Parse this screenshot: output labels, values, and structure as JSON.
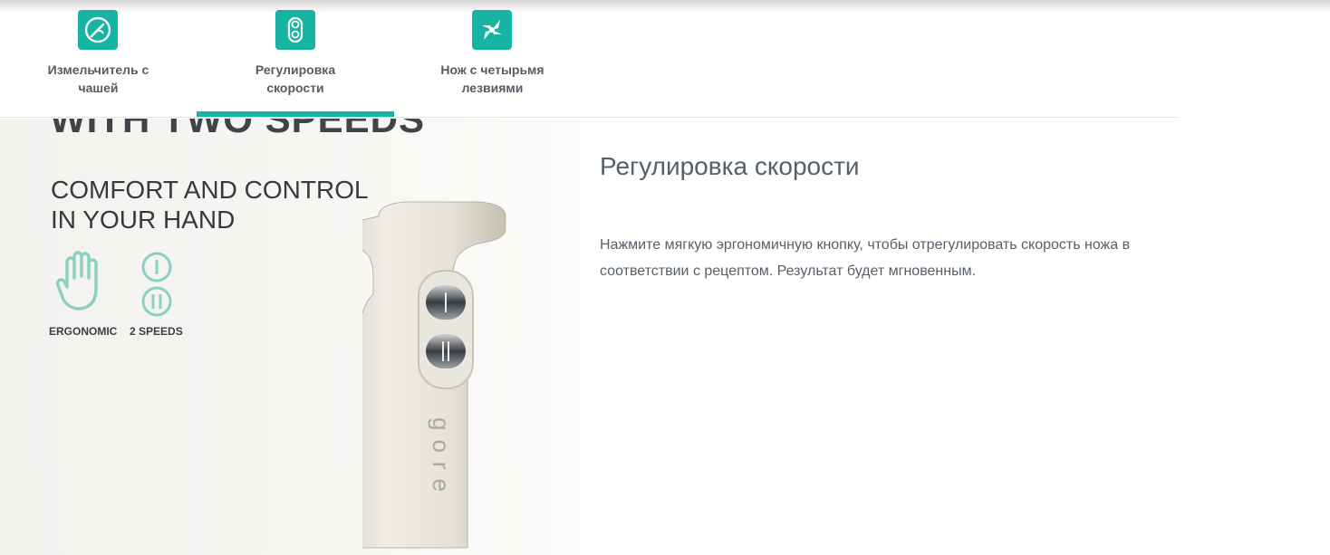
{
  "tabs": [
    {
      "label": "Измельчитель с чашей",
      "icon": "chopper-bowl-icon",
      "active": false
    },
    {
      "label": "Регулировка скорости",
      "icon": "speed-control-icon",
      "active": true
    },
    {
      "label": "Нож с четырьмя лезвиями",
      "icon": "four-blade-knife-icon",
      "active": false
    }
  ],
  "colors": {
    "accent": "#17b3a3",
    "text": "#55606a"
  },
  "product_image": {
    "headline_partial": "WITH TWO SPEEDS",
    "tagline_line1": "COMFORT AND CONTROL",
    "tagline_line2": "IN YOUR HAND",
    "feature_ergonomic": "ERGONOMIC",
    "feature_speeds": "2 SPEEDS",
    "speed_marks": [
      "I",
      "II"
    ],
    "brand": "gore"
  },
  "description": {
    "title": "Регулировка скорости",
    "text": "Нажмите мягкую эргономичную кнопку, чтобы отрегулировать скорость ножа в соответствии с рецептом. Результат будет мгновенным."
  }
}
